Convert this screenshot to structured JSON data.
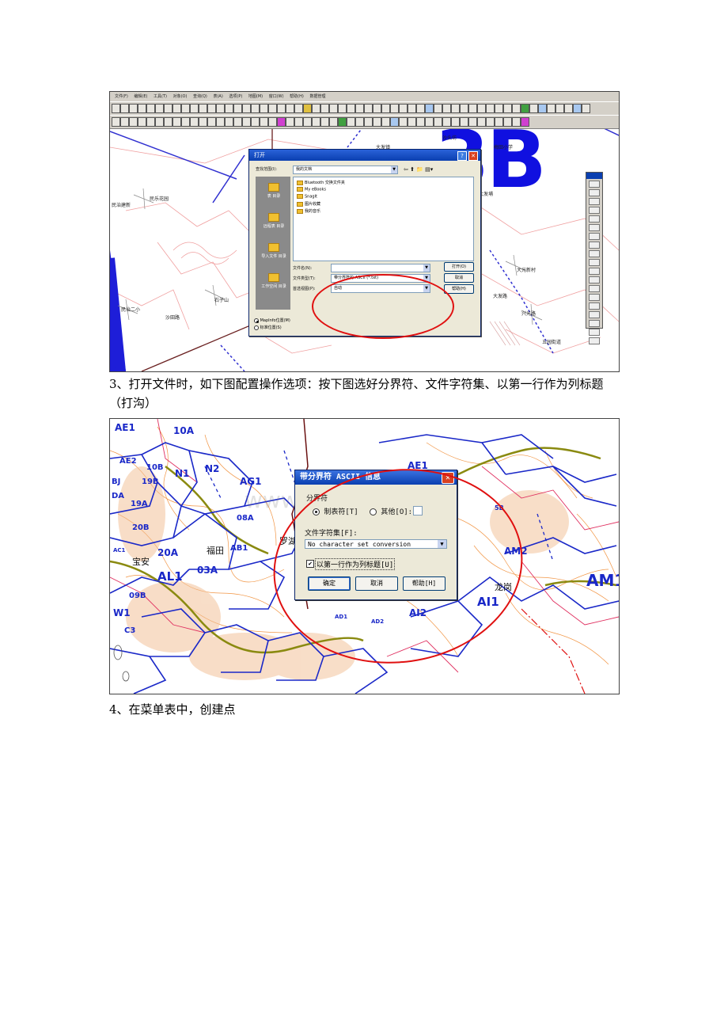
{
  "screenshot1": {
    "menu": [
      "文件(F)",
      "编辑(E)",
      "工具(T)",
      "对象(O)",
      "查询(Q)",
      "表(A)",
      "选项(P)",
      "地图(M)",
      "窗口(W)",
      "帮助(H)",
      "数据管理"
    ],
    "map_big_label": "3B",
    "map_labels": [
      "大发镇",
      "沙头坊",
      "梅田小学",
      "民乐花园",
      "石子山",
      "民治建新",
      "沙田路",
      "民治二小",
      "西丽",
      "大发埔",
      "大光新村",
      "五园街道",
      "兴光路",
      "大发路"
    ],
    "open_dialog": {
      "title": "打开",
      "help_btn": "?",
      "close_btn": "✕",
      "look_in_label": "查找范围(I):",
      "look_in_value": "我的文档",
      "places": [
        "表 目录",
        "远程表 目录",
        "导入文件 目录",
        "工作空间 目录"
      ],
      "files": [
        "Bluetooth 交换文件夹",
        "My eBooks",
        "SnagIt",
        "图片收藏",
        "我的音乐"
      ],
      "filename_label": "文件名(N):",
      "filename_value": "",
      "filetype_label": "文件类型(T):",
      "filetype_value": "带分界符的 ASCII (*.txt)",
      "preferred_view_label": "首选视图(P):",
      "preferred_view_value": "自动",
      "open_button": "打开(O)",
      "cancel_button": "取消",
      "help_button": "帮助(H)",
      "location_options": [
        "MapInfo位置(M)",
        "标准位置(S)"
      ]
    }
  },
  "caption3": "3、打开文件时，如下图配置操作选项：按下图选好分界符、文件字符集、以第一行作为列标题（打沟）",
  "screenshot2": {
    "watermark": "www.zixin.com.cn",
    "zone_labels": [
      "AE1",
      "10A",
      "AE2",
      "10B",
      "19B",
      "N1",
      "N2",
      "AG1",
      "BJ",
      "DA",
      "19A",
      "08A",
      "20B",
      "AC1",
      "20A",
      "AB1",
      "AL1",
      "03A",
      "09B",
      "W1",
      "C3",
      "AE1",
      "5B",
      "AM2",
      "AM1",
      "AI1",
      "AI2",
      "AD2",
      "AD1"
    ],
    "city_labels": [
      "福田",
      "罗湖",
      "龙岗",
      "宝安"
    ],
    "dialog": {
      "title": "带分界符 ASCII 信息",
      "close_btn": "✕",
      "delimiter_group": "分界符",
      "tab_option": "制表符[T]",
      "other_option": "其他[O]:",
      "charset_label": "文件字符集[F]:",
      "charset_value": "No character set conversion",
      "header_checkbox_label": "以第一行作为列标题[U]",
      "header_checkbox_checked": "✔",
      "ok_button": "确定",
      "cancel_button": "取消",
      "help_button": "帮助[H]"
    }
  },
  "caption4": "4、在菜单表中，创建点"
}
